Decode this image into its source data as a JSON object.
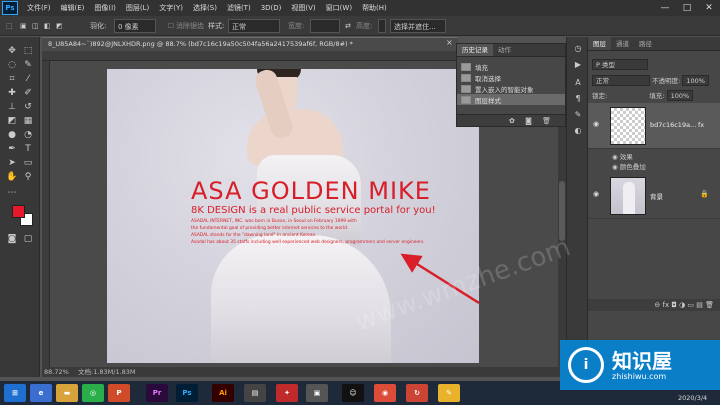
{
  "app": {
    "logo": "Ps",
    "menus": [
      "文件(F)",
      "编辑(E)",
      "图像(I)",
      "图层(L)",
      "文字(Y)",
      "选择(S)",
      "滤镜(T)",
      "3D(D)",
      "视图(V)",
      "窗口(W)",
      "帮助(H)"
    ],
    "window_controls": [
      "—",
      "□",
      "✕"
    ]
  },
  "options_bar": {
    "feather_label": "羽化:",
    "feather_value": "0 像素",
    "antialias_label": "消除锯齿",
    "style_label": "样式:",
    "style_value": "正常",
    "width_label": "宽度:",
    "height_label": "高度:",
    "select_mask_button": "选择并遮住..."
  },
  "document": {
    "tab_title": "8_U85A84~`)892@JNLXHDR.png @ 88.7% (bd7c16c19a50c504fa56a2417539af6f, RGB/8#) *",
    "tab_close": "×",
    "zoom_status": "88.72%",
    "doc_status": "文档:1.83M/1.83M",
    "poster": {
      "title": "ASA GOLDEN MIKE",
      "subtitle": "8K DESIGN is a real public service portal for you!",
      "lines": [
        "ASADAL INTERNET, INC. was born in Busan, in Seoul on February 1999 with",
        "the fundamental goal of providing better internet services to the world.",
        "ASADAL stands for the \"dawning land\" in ancient Korean.",
        "Asadal has about 35 staffs including well experienced web designers, programmers and server engineers."
      ]
    }
  },
  "history_panel": {
    "tabs": [
      "历史记录",
      "动作"
    ],
    "items": [
      "填充",
      "取消选择",
      "置入嵌入的智能对象",
      "图层样式"
    ],
    "selected_index": 3,
    "footer_icons": "✿ ◙ 🗑"
  },
  "layers_panel": {
    "tabs": [
      "图层",
      "通道",
      "路径"
    ],
    "filter_label": "P 类型",
    "blend_mode": "正常",
    "opacity_label": "不透明度:",
    "opacity_value": "100%",
    "lock_label": "锁定:",
    "fill_label": "填充:",
    "fill_value": "100%",
    "layer1_name": "bd7c16c19a...",
    "layer1_fx": "fx",
    "effects_label": "效果",
    "color_overlay_label": "颜色叠加",
    "layer2_name": "背景",
    "footer_icons": "⊖ fx ◘ ◑ ▭ ▤ 🗑"
  },
  "taskbar": {
    "apps": [
      "Ai",
      "Pr",
      "Ps",
      "Ai"
    ],
    "date": "2020/3/4"
  },
  "watermark": {
    "text": "www.wmzhe.com",
    "brand_name": "知识屋",
    "brand_url": "zhishiwu.com"
  },
  "colors": {
    "accent_red": "#d81e28",
    "ps_blue": "#31a8ff",
    "foreground_swatch": "#e6192b",
    "background_swatch": "#ffffff"
  }
}
